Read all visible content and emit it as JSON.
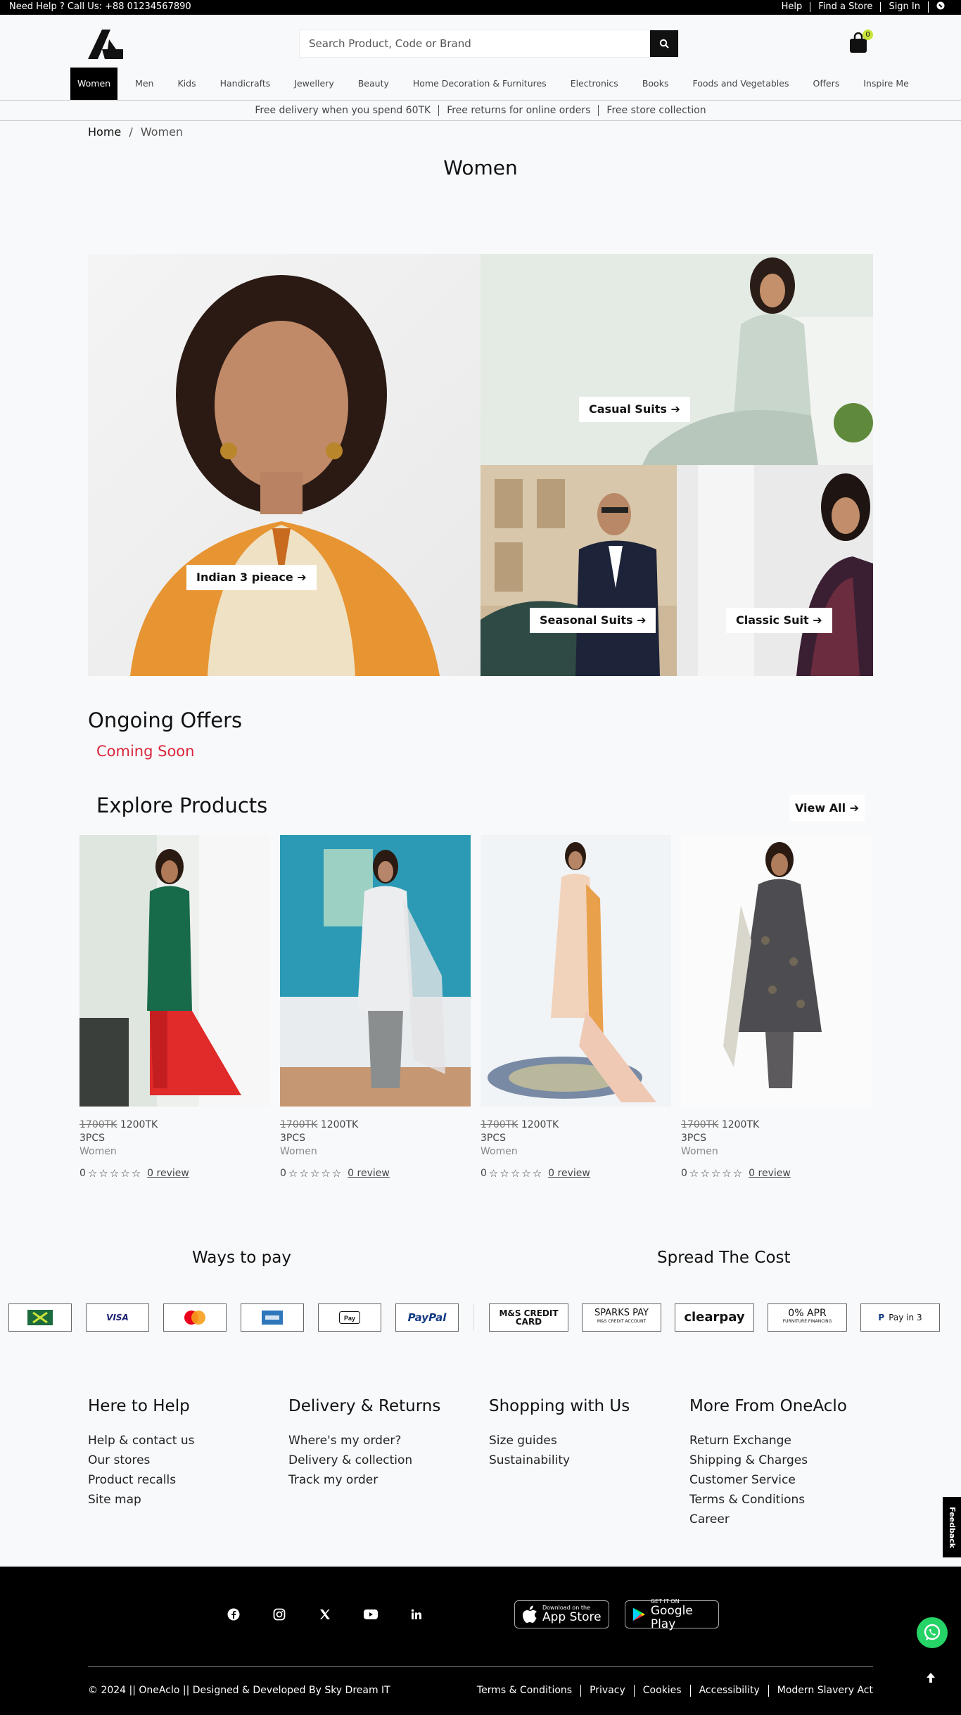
{
  "topbar": {
    "help_text": "Need Help ? Call Us: +88 01234567890",
    "links": [
      "Help",
      "Find a Store",
      "Sign In"
    ]
  },
  "header": {
    "search_placeholder": "Search Product, Code or Brand",
    "cart_count": "0"
  },
  "nav": [
    "Women",
    "Men",
    "Kids",
    "Handicrafts",
    "Jewellery",
    "Beauty",
    "Home Decoration & Furnitures",
    "Electronics",
    "Books",
    "Foods and Vegetables",
    "Offers",
    "Inspire Me"
  ],
  "promo": [
    "Free delivery when you spend 60TK",
    "Free returns for online orders",
    "Free store collection"
  ],
  "breadcrumb": {
    "home": "Home",
    "sep": "/",
    "current": "Women"
  },
  "page_title": "Women",
  "hero": {
    "indian": "Indian 3 pieace",
    "casual": "Casual Suits",
    "seasonal": "Seasonal Suits",
    "classic": "Classic Suit"
  },
  "offers": {
    "title": "Ongoing Offers",
    "status": "Coming Soon"
  },
  "explore": {
    "title": "Explore Products",
    "view_all": "View All"
  },
  "products": [
    {
      "old_price": "1700TK",
      "price": "1200TK",
      "qty": "3PCS",
      "category": "Women",
      "rating": "0",
      "reviews": "0 review"
    },
    {
      "old_price": "1700TK",
      "price": "1200TK",
      "qty": "3PCS",
      "category": "Women",
      "rating": "0",
      "reviews": "0 review"
    },
    {
      "old_price": "1700TK",
      "price": "1200TK",
      "qty": "3PCS",
      "category": "Women",
      "rating": "0",
      "reviews": "0 review"
    },
    {
      "old_price": "1700TK",
      "price": "1200TK",
      "qty": "3PCS",
      "category": "Women",
      "rating": "0",
      "reviews": "0 review"
    }
  ],
  "payments": {
    "ways_title": "Ways to pay",
    "spread_title": "Spread The Cost",
    "cards": [
      "VISA",
      "PayPal"
    ],
    "finance": [
      "M&S CREDIT CARD",
      "SPARKS PAY",
      "M&S CREDIT ACCOUNT",
      "clearpay",
      "0% APR",
      "FURNITURE FINANCING",
      "Pay in 3"
    ]
  },
  "footer": {
    "help": {
      "title": "Here to Help",
      "links": [
        "Help & contact us",
        "Our stores",
        "Product recalls",
        "Site map"
      ]
    },
    "delivery": {
      "title": "Delivery & Returns",
      "links": [
        "Where's my order?",
        "Delivery & collection",
        "Track my order"
      ]
    },
    "shopping": {
      "title": "Shopping with Us",
      "links": [
        "Size guides",
        "Sustainability"
      ]
    },
    "more": {
      "title": "More From OneAclo",
      "links": [
        "Return Exchange",
        "Shipping & Charges",
        "Customer Service",
        "Terms & Conditions",
        "Career"
      ]
    },
    "feedback": "Feedback"
  },
  "bottom": {
    "appstore_small": "Download on the",
    "appstore": "App Store",
    "googleplay_small": "GET IT ON",
    "googleplay": "Google Play",
    "copyright": "© 2024 || OneAclo || Designed & Developed By Sky Dream IT",
    "legal": [
      "Terms & Conditions",
      "Privacy",
      "Cookies",
      "Accessibility",
      "Modern Slavery Act"
    ]
  },
  "colors": {
    "accent_red": "#d9263b",
    "badge_green": "#c8e33b",
    "whatsapp": "#25d366"
  }
}
